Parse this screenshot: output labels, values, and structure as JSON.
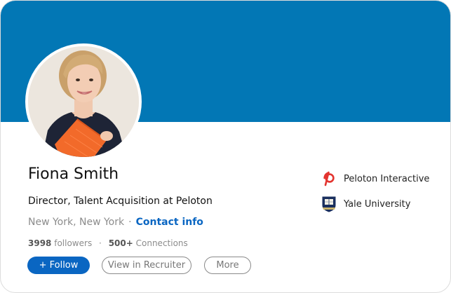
{
  "profile": {
    "name": "Fiona Smith",
    "headline": "Director, Talent Acquisition at Peloton",
    "location": "New York, New York",
    "separator": "·",
    "contact_info_label": "Contact info",
    "followers_count": "3998",
    "followers_label": "followers",
    "connections_count": "500+",
    "connections_label": "Connections"
  },
  "actions": {
    "follow_label": "+ Follow",
    "recruiter_label": "View in Recruiter",
    "more_label": "More"
  },
  "sidebar": {
    "items": [
      {
        "label": "Peloton Interactive",
        "icon": "peloton-logo-icon"
      },
      {
        "label": "Yale University",
        "icon": "yale-shield-icon"
      }
    ]
  },
  "colors": {
    "banner": "#0277b5",
    "primary": "#0a66c2",
    "peloton_red": "#e3342f",
    "yale_navy": "#1a2f5e"
  }
}
